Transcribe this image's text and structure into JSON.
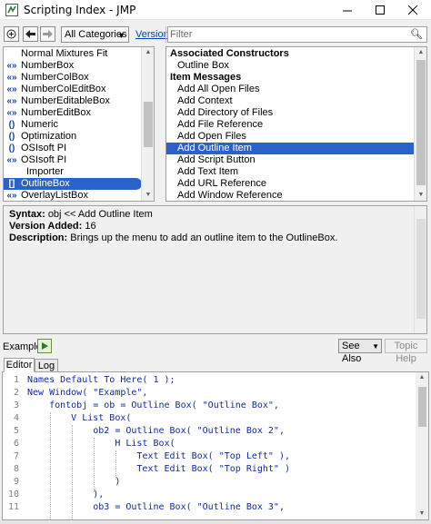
{
  "window": {
    "title": "Scripting Index - JMP",
    "minimize": "—",
    "maximize": "☐",
    "close": "✕"
  },
  "toolbar": {
    "category_select": "All Categories",
    "version_link": "Version",
    "filter_placeholder": "Filter",
    "filter_value": ""
  },
  "left_list": {
    "items": [
      {
        "icon": "",
        "label": "Normal Mixtures Fit"
      },
      {
        "icon": "«»",
        "label": "NumberBox"
      },
      {
        "icon": "«»",
        "label": "NumberColBox"
      },
      {
        "icon": "«»",
        "label": "NumberColEditBox"
      },
      {
        "icon": "«»",
        "label": "NumberEditableBox"
      },
      {
        "icon": "«»",
        "label": "NumberEditBox"
      },
      {
        "icon": "()",
        "label": "Numeric"
      },
      {
        "icon": "()",
        "label": "Optimization"
      },
      {
        "icon": "()",
        "label": "OSIsoft PI"
      },
      {
        "icon": "«»",
        "label": "OSIsoft PI"
      },
      {
        "icon": "",
        "label": "Importer"
      },
      {
        "icon": "[]",
        "label": "OutlineBox"
      },
      {
        "icon": "«»",
        "label": "OverlayListBox"
      }
    ]
  },
  "right_list": {
    "section_constructors": "Associated Constructors",
    "constructors": [
      "Outline Box"
    ],
    "section_messages": "Item Messages",
    "messages": [
      "Add All Open Files",
      "Add Context",
      "Add Directory of Files",
      "Add File Reference",
      "Add Open Files",
      "Add Outline Item",
      "Add Script Button",
      "Add Text Item",
      "Add URL Reference",
      "Add Window Reference"
    ]
  },
  "description": {
    "syntax_label": "Syntax:",
    "syntax_value": "obj << Add Outline Item",
    "version_label": "Version Added:",
    "version_value": "16",
    "desc_label": "Description:",
    "desc_value": "Brings up the menu to add an outline item to the OutlineBox."
  },
  "example_bar": {
    "label": "Example",
    "see_also": "See Also",
    "topic_help": "Topic Help"
  },
  "editor_tabs": {
    "editor": "Editor",
    "log": "Log"
  },
  "code": {
    "line_numbers": [
      "1",
      "2",
      "3",
      "4",
      "5",
      "6",
      "7",
      "8",
      "9",
      "10",
      "11"
    ],
    "lines": [
      "Names Default To Here( 1 );",
      "New Window( \"Example\",",
      "    fontobj = ob = Outline Box( \"Outline Box\",",
      "        V List Box(",
      "            ob2 = Outline Box( \"Outline Box 2\",",
      "                H List Box(",
      "                    Text Edit Box( \"Top Left\" ),",
      "                    Text Edit Box( \"Top Right\" )",
      "                )",
      "            ),",
      "            ob3 = Outline Box( \"Outline Box 3\","
    ]
  },
  "colors": {
    "selection": "#2a62c9",
    "code_text": "#0c2aa8",
    "link": "#0645ad"
  }
}
